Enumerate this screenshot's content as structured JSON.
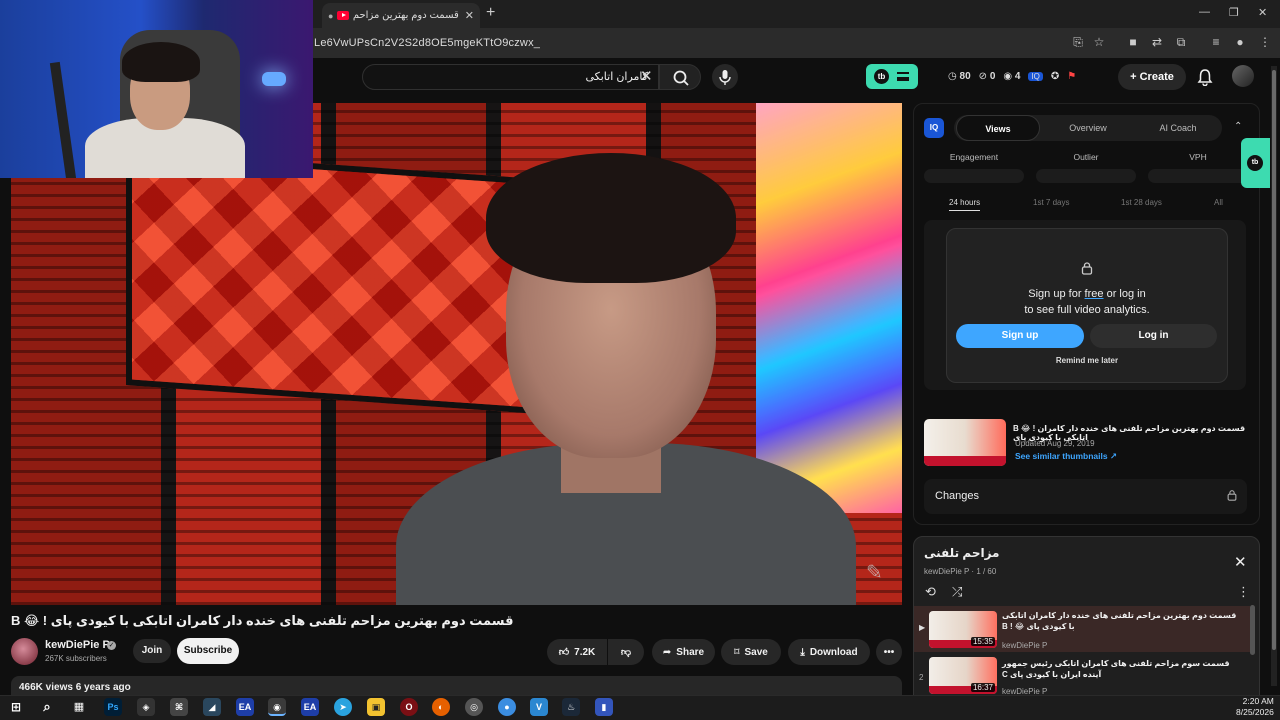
{
  "browser": {
    "tab_title": "قسمت دوم بهترین مزاحم تلفنی",
    "url": "Le6VwUPsCn2V2S2d8OE5mgeKTtO9czwx_"
  },
  "youtube_header": {
    "search_value": "کامران اتابکی",
    "create_label": "Create",
    "stats": [
      "80",
      "0",
      "4"
    ]
  },
  "video": {
    "title": "B 😂 ! قسمت دوم بهترین مزاحم تلفنی های خنده دار کامران اتابکی با کیودی پای",
    "channel": "kewDiePie P",
    "subscribers": "267K subscribers",
    "join_label": "Join",
    "subscribe_label": "Subscribe",
    "likes": "7.2K",
    "share_label": "Share",
    "save_label": "Save",
    "download_label": "Download",
    "views_line": "466K views  6 years ago"
  },
  "panel": {
    "logo": "IQ",
    "tabs": [
      "Views",
      "Overview",
      "AI Coach"
    ],
    "metrics": [
      "Engagement",
      "Outlier",
      "VPH"
    ],
    "ranges": [
      "24 hours",
      "1st 7 days",
      "1st 28 days",
      "All"
    ],
    "signin_line1_pre": "Sign up for ",
    "signin_line1_free": "free",
    "signin_line1_post": " or log in",
    "signin_line2": "to see full video analytics.",
    "signup_label": "Sign up",
    "login_label": "Log in",
    "remind_label": "Remind me later",
    "thumb_title": "B 😂 ! قسمت دوم بهترین مزاحم تلفنی های خنده دار کامران اتابکی با کیودی پای",
    "thumb_updated": "Updated Aug 29, 2019",
    "thumb_link": "See similar thumbnails ↗",
    "changes_label": "Changes"
  },
  "playlist": {
    "title": "مزاحم تلفنی",
    "subtitle": "kewDiePie P · 1 / 60",
    "items": [
      {
        "index": "▶",
        "title": "قسمت دوم بهترین مزاحم تلفنی های خنده دار کامران اتابکی با کیودی پای 😂 ! B",
        "channel": "kewDiePie P",
        "duration": "15:35"
      },
      {
        "index": "2",
        "title": "قسمت سوم مزاحم تلفنی های کامران اتابکی رئیس جمهور آینده ایران با کیودی پای C",
        "channel": "kewDiePie P",
        "duration": "16:37"
      }
    ]
  },
  "clock": {
    "time": "2:20 AM",
    "date": "8/25/2026"
  },
  "colors": {
    "accent_teal": "#3ddbb0",
    "accent_blue": "#3ea6ff",
    "youtube_red": "#ff0033"
  }
}
